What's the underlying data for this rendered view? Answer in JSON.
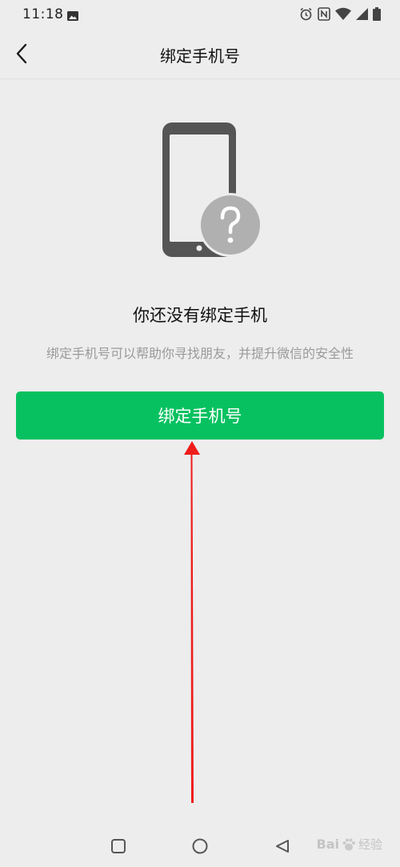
{
  "status_bar": {
    "time": "11:18",
    "icons": [
      "gallery-icon",
      "alarm-icon",
      "nfc-icon",
      "wifi-icon",
      "signal-icon",
      "battery-icon"
    ]
  },
  "header": {
    "title": "绑定手机号",
    "back_icon": "chevron-left-icon"
  },
  "main": {
    "illustration": "phone-question-icon",
    "headline": "你还没有绑定手机",
    "description": "绑定手机号可以帮助你寻找朋友，并提升微信的安全性",
    "button_label": "绑定手机号"
  },
  "system_nav": {
    "icons": [
      "recents-square-icon",
      "home-circle-icon",
      "back-triangle-icon"
    ]
  },
  "watermark": {
    "brand": "Bai",
    "suffix": "经验"
  },
  "colors": {
    "background": "#ededed",
    "accent": "#07c160",
    "illustration_gray": "#555555",
    "question_circle": "#b0b0b0",
    "annotation_arrow": "#ee1c1c"
  }
}
